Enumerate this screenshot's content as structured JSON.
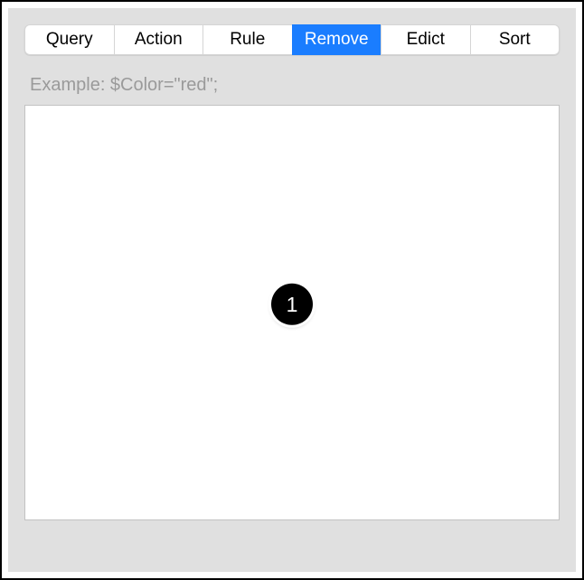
{
  "tabs": [
    {
      "label": "Query",
      "active": false
    },
    {
      "label": "Action",
      "active": false
    },
    {
      "label": "Rule",
      "active": false
    },
    {
      "label": "Remove",
      "active": true
    },
    {
      "label": "Edict",
      "active": false
    },
    {
      "label": "Sort",
      "active": false
    }
  ],
  "example_label": "Example: $Color=\"red\";",
  "textarea_value": "",
  "marker_label": "1"
}
